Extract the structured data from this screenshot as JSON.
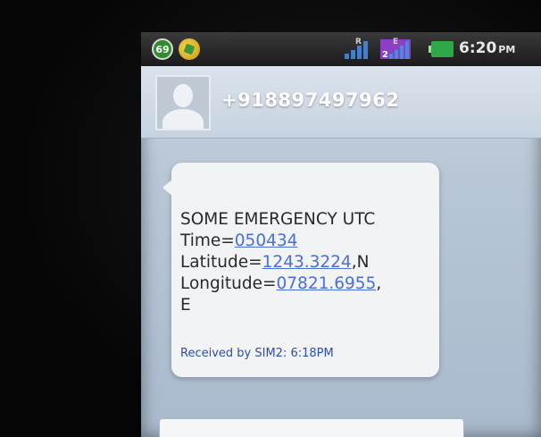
{
  "status_bar": {
    "notification_count": "69",
    "signal1_label": "R",
    "signal2_label": "E",
    "signal2_slot": "2",
    "time": "6:20",
    "ampm": "PM"
  },
  "contact": {
    "number": "+918897497962"
  },
  "message": {
    "line1": "SOME EMERGENCY UTC",
    "time_label": "Time=",
    "time_value": "050434",
    "latitude_label": "Latitude=",
    "latitude_value": "1243.3224",
    "latitude_suffix": ",N",
    "longitude_label": "Longitude=",
    "longitude_value": "07821.6955",
    "longitude_suffix": ",",
    "last_line": "E",
    "received": "Received by SIM2: 6:18PM"
  },
  "colors": {
    "link": "#4a6fd8",
    "received_text": "#2e4fa6",
    "battery": "#2fa84a"
  }
}
